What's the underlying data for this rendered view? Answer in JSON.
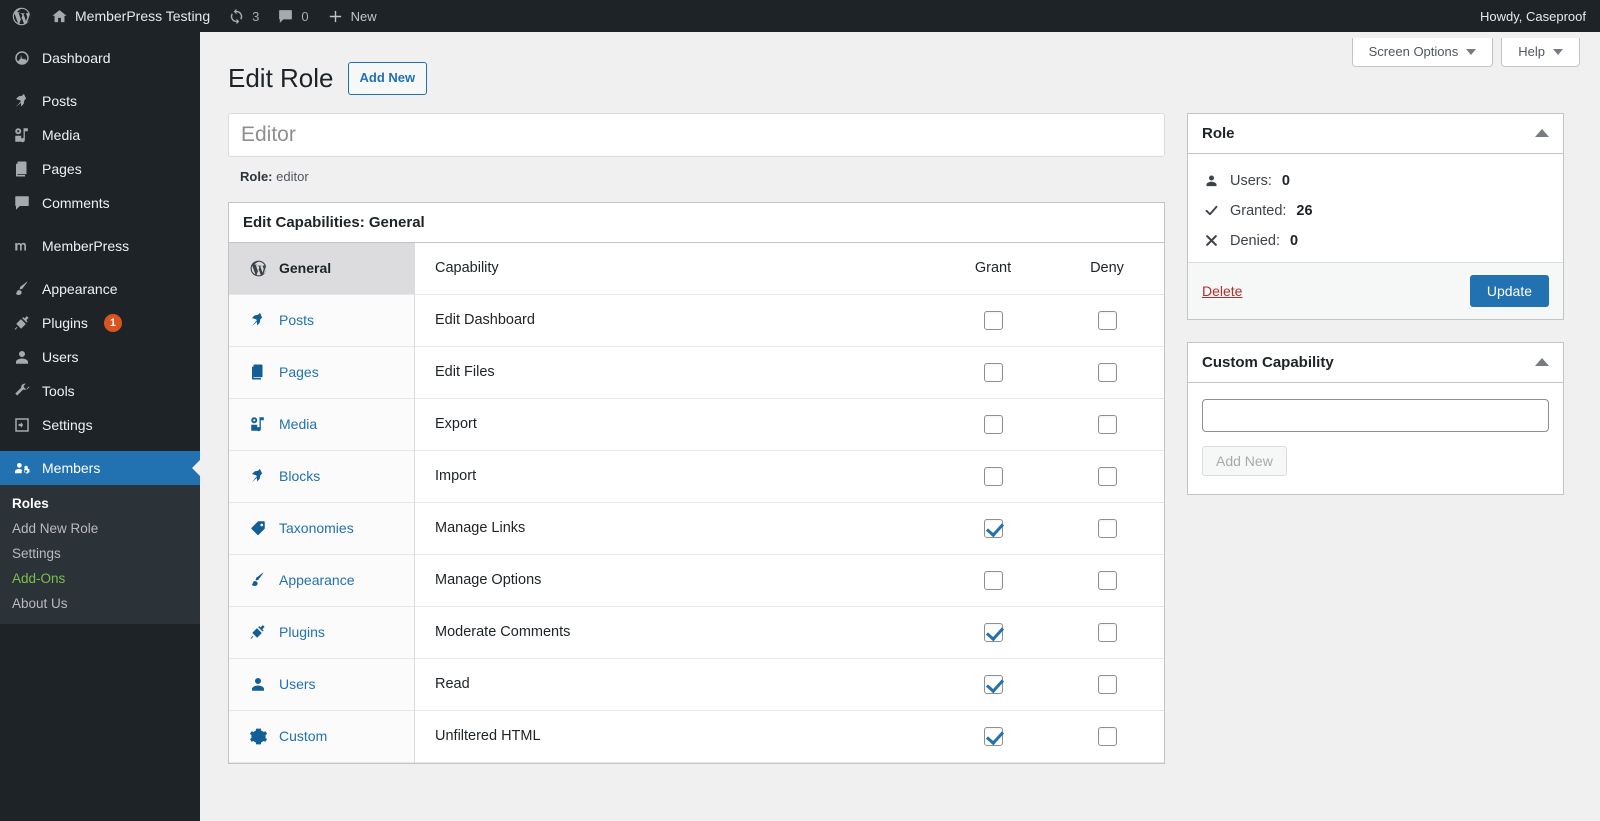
{
  "adminbar": {
    "logo_icon": "wordpress-logo-icon",
    "home_icon": "home-icon",
    "site_name": "MemberPress Testing",
    "updates_icon": "updates-icon",
    "updates_count": "3",
    "comments_icon": "comment-bubble-icon",
    "comments_count": "0",
    "new_icon": "plus-icon",
    "new_label": "New",
    "howdy": "Howdy, Caseproof"
  },
  "sidebar": {
    "items": [
      {
        "label": "Dashboard",
        "icon": "dashboard-icon"
      },
      {
        "label": "Posts",
        "icon": "pin-icon"
      },
      {
        "label": "Media",
        "icon": "media-icon"
      },
      {
        "label": "Pages",
        "icon": "pages-icon"
      },
      {
        "label": "Comments",
        "icon": "comment-icon"
      },
      {
        "label": "MemberPress",
        "icon": "memberpress-icon"
      },
      {
        "label": "Appearance",
        "icon": "paintbrush-icon"
      },
      {
        "label": "Plugins",
        "icon": "plug-icon",
        "badge": "1"
      },
      {
        "label": "Users",
        "icon": "user-icon"
      },
      {
        "label": "Tools",
        "icon": "wrench-icon"
      },
      {
        "label": "Settings",
        "icon": "settings-icon"
      },
      {
        "label": "Members",
        "icon": "members-icon",
        "active": true
      }
    ],
    "submenu": [
      {
        "label": "Roles",
        "state": "current"
      },
      {
        "label": "Add New Role",
        "state": "normal"
      },
      {
        "label": "Settings",
        "state": "normal"
      },
      {
        "label": "Add-Ons",
        "state": "highlight"
      },
      {
        "label": "About Us",
        "state": "normal"
      }
    ]
  },
  "screen_meta": {
    "screen_options": "Screen Options",
    "help": "Help"
  },
  "page": {
    "title": "Edit Role",
    "add_new_label": "Add New",
    "role_name_value": "Editor",
    "role_slug_label": "Role:",
    "role_slug_value": "editor"
  },
  "capabilities_box": {
    "heading": "Edit Capabilities: General",
    "tabs": [
      {
        "label": "General",
        "icon": "wordpress-logo-icon",
        "active": true
      },
      {
        "label": "Posts",
        "icon": "pin-icon"
      },
      {
        "label": "Pages",
        "icon": "pages-icon"
      },
      {
        "label": "Media",
        "icon": "media-icon"
      },
      {
        "label": "Blocks",
        "icon": "pin-icon"
      },
      {
        "label": "Taxonomies",
        "icon": "tag-icon"
      },
      {
        "label": "Appearance",
        "icon": "paintbrush-icon"
      },
      {
        "label": "Plugins",
        "icon": "plug-icon"
      },
      {
        "label": "Users",
        "icon": "user-icon"
      },
      {
        "label": "Custom",
        "icon": "gear-icon"
      }
    ],
    "columns": {
      "capability": "Capability",
      "grant": "Grant",
      "deny": "Deny"
    },
    "rows": [
      {
        "name": "Edit Dashboard",
        "grant": false,
        "deny": false
      },
      {
        "name": "Edit Files",
        "grant": false,
        "deny": false
      },
      {
        "name": "Export",
        "grant": false,
        "deny": false
      },
      {
        "name": "Import",
        "grant": false,
        "deny": false
      },
      {
        "name": "Manage Links",
        "grant": true,
        "deny": false
      },
      {
        "name": "Manage Options",
        "grant": false,
        "deny": false
      },
      {
        "name": "Moderate Comments",
        "grant": true,
        "deny": false
      },
      {
        "name": "Read",
        "grant": true,
        "deny": false
      },
      {
        "name": "Unfiltered HTML",
        "grant": true,
        "deny": false
      }
    ]
  },
  "role_panel": {
    "title": "Role",
    "users_label": "Users:",
    "users_value": "0",
    "granted_label": "Granted:",
    "granted_value": "26",
    "denied_label": "Denied:",
    "denied_value": "0",
    "delete_label": "Delete",
    "update_label": "Update"
  },
  "custom_capability_panel": {
    "title": "Custom Capability",
    "input_value": "",
    "input_placeholder": "",
    "add_new_label": "Add New"
  },
  "colors": {
    "admin_bar": "#1d2327",
    "sidebar": "#1d2327",
    "accent": "#2271b1",
    "link": "#2271b1",
    "danger": "#b32d2e",
    "badge": "#d9541e",
    "highlight_green": "#7cc04c"
  }
}
